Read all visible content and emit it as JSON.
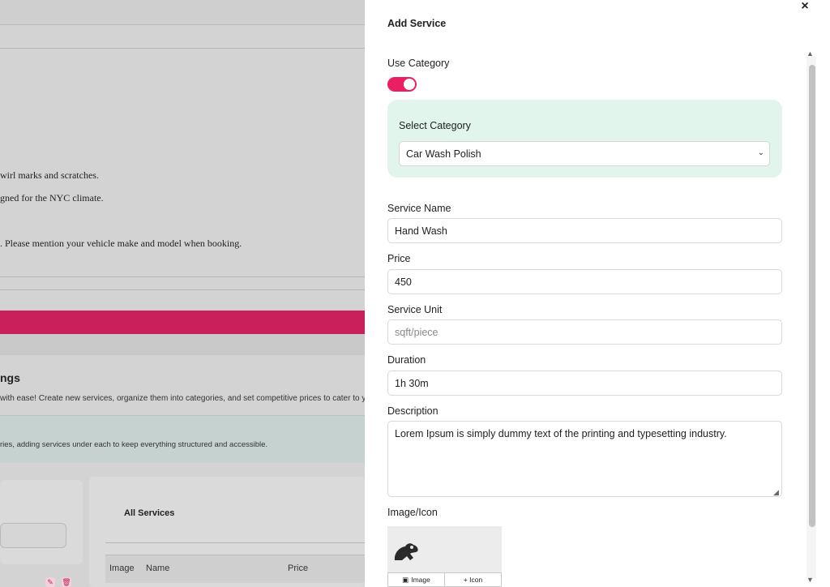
{
  "background": {
    "line1": "wirl marks and scratches.",
    "line2": "gned for the NYC climate.",
    "line3": ". Please mention your vehicle make and model when booking.",
    "heading": "ngs",
    "subtext": " with ease! Create new services, organize them into categories, and set competitive prices to cater to your",
    "info": "ries, adding services under each to keep everything structured and accessible.",
    "table_title": "All Services",
    "columns": [
      "Image",
      "Name",
      "Price"
    ],
    "accent": "#c91f5b"
  },
  "drawer": {
    "title": "Add Service",
    "close_glyph": "×",
    "use_category_label": "Use Category",
    "use_category_on": true,
    "select_category_label": "Select Category",
    "select_category_value": "Car Wash Polish",
    "service_name_label": "Service Name",
    "service_name_value": "Hand Wash",
    "price_label": "Price",
    "price_value": "450",
    "service_unit_label": "Service Unit",
    "service_unit_placeholder": "sqft/piece",
    "duration_label": "Duration",
    "duration_value": "1h 30m",
    "description_label": "Description",
    "description_value": "Lorem Ipsum is simply dummy text of the printing and typesetting industry.",
    "image_icon_label": "Image/Icon",
    "image_button": "Image",
    "icon_button": "+ Icon",
    "toggle_color": "#e91e63",
    "category_box_color": "#e1f5ec"
  }
}
